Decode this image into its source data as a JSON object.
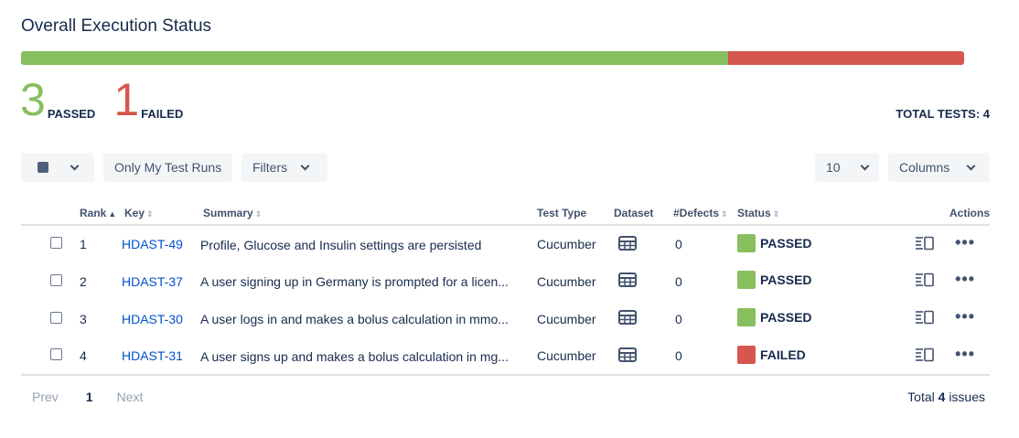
{
  "header": {
    "title": "Overall Execution Status"
  },
  "progress": {
    "passed": 3,
    "failed": 1,
    "total": 4,
    "colors": {
      "passed": "#87bf5e",
      "failed": "#d6574f"
    }
  },
  "summary": {
    "passed_count": "3",
    "passed_label": "PASSED",
    "failed_count": "1",
    "failed_label": "FAILED",
    "total_label": "TOTAL TESTS: 4"
  },
  "toolbar": {
    "select_icon": "square-icon",
    "only_my_label": "Only My Test Runs",
    "filters_label": "Filters",
    "page_size": "10",
    "columns_label": "Columns"
  },
  "table": {
    "headers": {
      "rank": "Rank",
      "key": "Key",
      "summary": "Summary",
      "test_type": "Test Type",
      "dataset": "Dataset",
      "defects": "#Defects",
      "status": "Status",
      "actions": "Actions"
    },
    "rows": [
      {
        "rank": "1",
        "key": "HDAST-49",
        "summary": "Profile, Glucose and Insulin settings are persisted",
        "test_type": "Cucumber",
        "defects": "0",
        "status": "PASSED",
        "status_color": "#87bf5e"
      },
      {
        "rank": "2",
        "key": "HDAST-37",
        "summary": "A user signing up in Germany is prompted for a licen...",
        "test_type": "Cucumber",
        "defects": "0",
        "status": "PASSED",
        "status_color": "#87bf5e"
      },
      {
        "rank": "3",
        "key": "HDAST-30",
        "summary": "A user logs in and makes a bolus calculation in mmo...",
        "test_type": "Cucumber",
        "defects": "0",
        "status": "PASSED",
        "status_color": "#87bf5e"
      },
      {
        "rank": "4",
        "key": "HDAST-31",
        "summary": "A user signs up and makes a bolus calculation in mg...",
        "test_type": "Cucumber",
        "defects": "0",
        "status": "FAILED",
        "status_color": "#d6574f"
      }
    ]
  },
  "pagination": {
    "prev_label": "Prev",
    "current_page": "1",
    "next_label": "Next",
    "total_prefix": "Total",
    "total_count": "4",
    "total_suffix": "issues"
  }
}
